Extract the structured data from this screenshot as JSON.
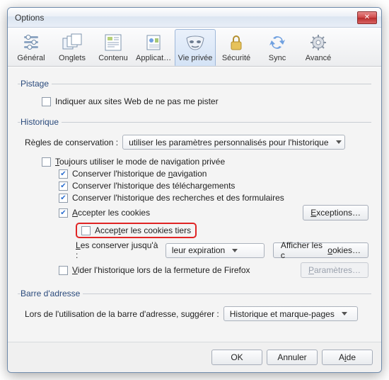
{
  "title": "Options",
  "tabs": {
    "general": "Général",
    "onglets": "Onglets",
    "contenu": "Contenu",
    "apps": "Applications",
    "vieprivee": "Vie privée",
    "securite": "Sécurité",
    "sync": "Sync",
    "avance": "Avancé"
  },
  "sections": {
    "pistage": "Pistage",
    "historique": "Historique",
    "barre": "Barre d'adresse"
  },
  "pistage": {
    "dnt": "Indiquer aux sites Web de ne pas me pister"
  },
  "hist": {
    "rulesLabel": "Règles de conservation :",
    "rulesValue": "utiliser les paramètres personnalisés pour l'historique",
    "alwaysPrivate": "Toujours utiliser le mode de navigation privée",
    "keepNav": "Conserver l'historique de navigation",
    "keepDl": "Conserver l'historique des téléchargements",
    "keepForm": "Conserver l'historique des recherches et des formulaires",
    "acceptCookies": "Accepter les cookies",
    "acceptThird": "Accepter les cookies tiers",
    "keepUntilLabel": "Les conserver jusqu'à :",
    "keepUntilValue": "leur expiration",
    "clearOnClose": "Vider l'historique lors de la fermeture de Firefox",
    "exceptions": "Exceptions…",
    "showCookies": "Afficher les cookies…",
    "params": "Paramètres…"
  },
  "barre": {
    "label": "Lors de l'utilisation de la barre d'adresse, suggérer :",
    "value": "Historique et marque-pages"
  },
  "footer": {
    "ok": "OK",
    "cancel": "Annuler",
    "help": "Aide"
  },
  "underline": {
    "alwaysPrivateFirst": "T",
    "alwaysPrivateRest": "oujours utiliser le mode de navigation privée",
    "keepNavA": "Conserver l'historique de ",
    "keepNavU": "n",
    "keepNavB": "avigation",
    "acceptCookiesA": "",
    "acceptCookiesU": "A",
    "acceptCookiesB": "ccepter les cookies",
    "acceptThirdA": "Accep",
    "acceptThirdU": "t",
    "acceptThirdB": "er les cookies tiers",
    "keepUntilA": "",
    "keepUntilU": "L",
    "keepUntilB": "es conserver jusqu'à :",
    "clearCloseA": "",
    "clearCloseU": "V",
    "clearCloseB": "ider l'historique lors de la fermeture de Firefox",
    "exceptionsA": "",
    "exceptionsU": "E",
    "exceptionsB": "xceptions…",
    "showCookiesA": "Afficher les c",
    "showCookiesU": "o",
    "showCookiesB": "okies…",
    "paramsA": "",
    "paramsU": "P",
    "paramsB": "aramètres…",
    "helpA": "A",
    "helpU": "i",
    "helpB": "de"
  }
}
